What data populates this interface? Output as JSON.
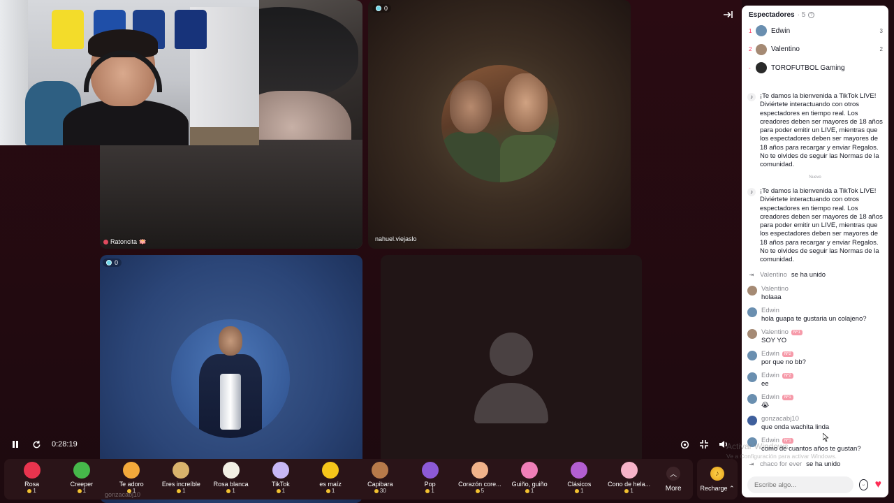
{
  "stream": {
    "time": "0:28:19",
    "tiles": [
      {
        "name": "Ratoncita 🪷",
        "viewers": ""
      },
      {
        "name": "nahuel.viejaslo",
        "viewers": "0"
      },
      {
        "name": "gonzacabj10",
        "viewers": "0"
      }
    ]
  },
  "gifts": [
    {
      "name": "Rosa",
      "price": "1",
      "color": "#e8344e",
      "icon": "rose-icon"
    },
    {
      "name": "Creeper",
      "price": "1",
      "color": "#46b84a",
      "icon": "creeper-icon"
    },
    {
      "name": "Te adoro",
      "price": "1",
      "color": "#f3a93b",
      "icon": "heart-face-icon"
    },
    {
      "name": "Eres increíble",
      "price": "1",
      "color": "#d9b36c",
      "icon": "cat-icon"
    },
    {
      "name": "Rosa blanca",
      "price": "1",
      "color": "#f2efe4",
      "icon": "white-rose-icon"
    },
    {
      "name": "TikTok",
      "price": "1",
      "color": "#c8b7f5",
      "icon": "tiktok-icon"
    },
    {
      "name": "es maíz",
      "price": "1",
      "color": "#f5c51a",
      "icon": "corn-icon"
    },
    {
      "name": "Capibara",
      "price": "30",
      "color": "#b77a4a",
      "icon": "capybara-icon"
    },
    {
      "name": "Pop",
      "price": "1",
      "color": "#8c5ad6",
      "icon": "pop-icon"
    },
    {
      "name": "Corazón core...",
      "price": "5",
      "color": "#f0b28a",
      "icon": "finger-heart-icon"
    },
    {
      "name": "Guiño, guiño",
      "price": "1",
      "color": "#ef7fb8",
      "icon": "wink-icon"
    },
    {
      "name": "Clásicos",
      "price": "1",
      "color": "#b35fd1",
      "icon": "radio-icon"
    },
    {
      "name": "Cono de hela...",
      "price": "1",
      "color": "#f6b3c8",
      "icon": "ice-cream-icon"
    }
  ],
  "giftbar": {
    "more_label": "More",
    "recharge_label": "Recharge ⌃"
  },
  "panel": {
    "title": "Espectadores",
    "count": "· 5",
    "ranking": [
      {
        "rank": "1",
        "name": "Edwin",
        "score": "3",
        "color": "#6a8fb0"
      },
      {
        "rank": "2",
        "name": "Valentino",
        "score": "2",
        "color": "#a58a74"
      },
      {
        "rank": "-",
        "name": "TOROFUTBOL Gaming",
        "score": "",
        "color": "#2a2a2a"
      }
    ],
    "welcome": "¡Te damos la bienvenida a TikTok LIVE! Diviértete interactuando con otros espectadores en tiempo real. Los creadores deben ser mayores de 18 años para poder emitir un LIVE, mientras que los espectadores deben ser mayores de 18 años para recargar y enviar Regalos. No te olvides de seguir las Normas de la comunidad.",
    "nuevo": "Nuevo",
    "joined_suffix": "se ha unido",
    "join1": "Valentino",
    "chat": [
      {
        "user": "Valentino",
        "level": "",
        "text": "holaaa",
        "color": "#a58a74"
      },
      {
        "user": "Edwin",
        "level": "",
        "text": "hola guapa te gustaria un colajeno?",
        "color": "#6a8fb0"
      },
      {
        "user": "Valentino",
        "level": "Nº1",
        "text": "SOY YO",
        "color": "#a58a74"
      },
      {
        "user": "Edwin",
        "level": "Nº2",
        "text": "por que no bb?",
        "color": "#6a8fb0"
      },
      {
        "user": "Edwin",
        "level": "Nº2",
        "text": "ee",
        "color": "#6a8fb0"
      },
      {
        "user": "Edwin",
        "level": "Nº1",
        "text": "😭",
        "color": "#6a8fb0"
      },
      {
        "user": "gonzacabj10",
        "level": "",
        "text": "que onda wachita linda",
        "color": "#3f5f9c"
      },
      {
        "user": "Edwin",
        "level": "Nº1",
        "text": "como de cuantos años te gustan?",
        "color": "#6a8fb0"
      }
    ],
    "join2": "chaco for ever",
    "input_placeholder": "Escribe algo...",
    "windows_watermark": "Activar Windows",
    "windows_watermark2": "Ve a Configuración para activar Windows."
  }
}
